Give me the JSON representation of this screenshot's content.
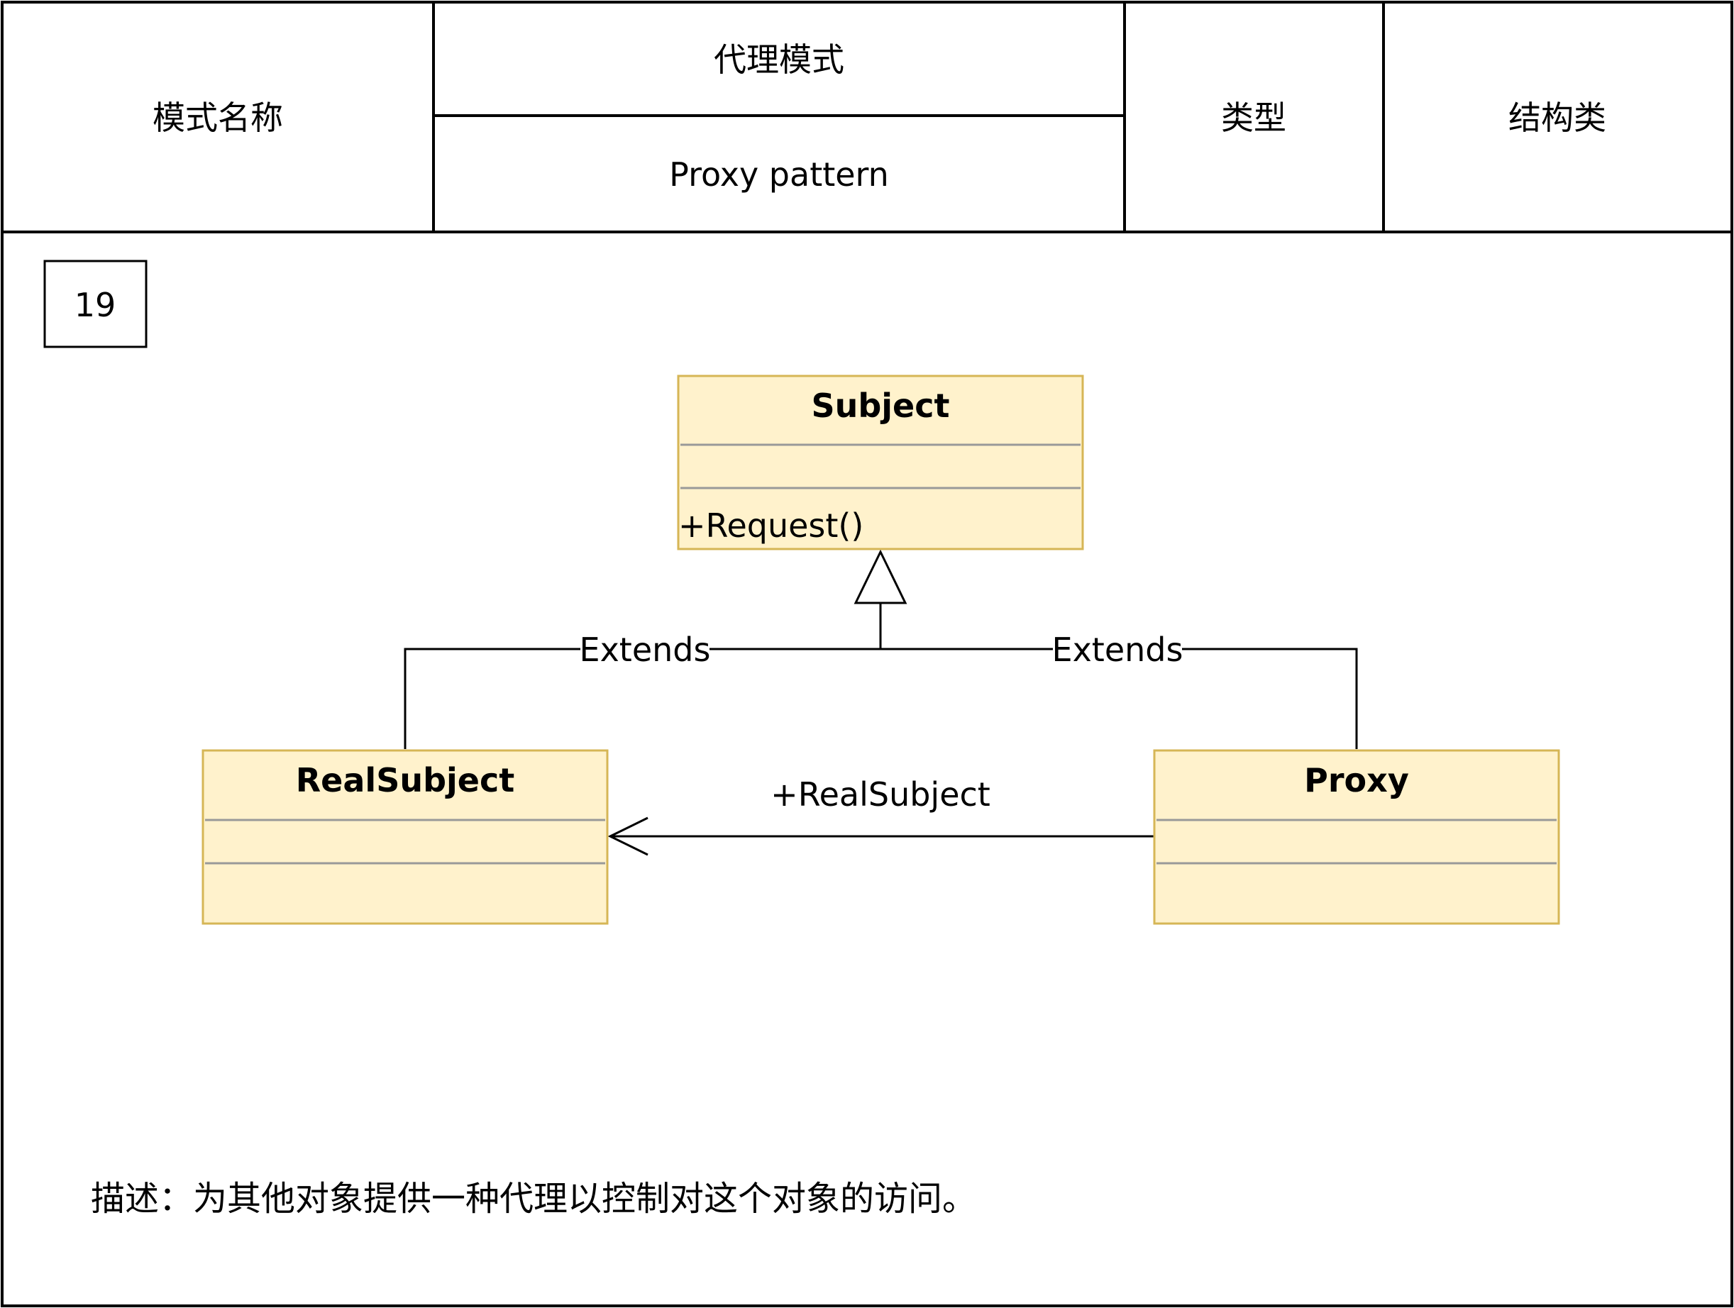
{
  "header": {
    "name_label": "模式名称",
    "name_cn": "代理模式",
    "name_en": "Proxy pattern",
    "type_label": "类型",
    "type_value": "结构类"
  },
  "badge": {
    "number": "19"
  },
  "diagram": {
    "classes": {
      "subject": {
        "name": "Subject",
        "attributes": "",
        "operations": "+Request()"
      },
      "real_subject": {
        "name": "RealSubject",
        "attributes": "",
        "operations": ""
      },
      "proxy": {
        "name": "Proxy",
        "attributes": "",
        "operations": ""
      }
    },
    "edges": {
      "real_extends": "Extends",
      "proxy_extends": "Extends",
      "association": "+RealSubject"
    }
  },
  "description": {
    "text": "描述：为其他对象提供一种代理以控制对这个对象的访问。"
  },
  "colors": {
    "class_fill": "#fff2cc",
    "class_border": "#d6b656",
    "compartment_line": "#999999",
    "line": "#000000"
  }
}
